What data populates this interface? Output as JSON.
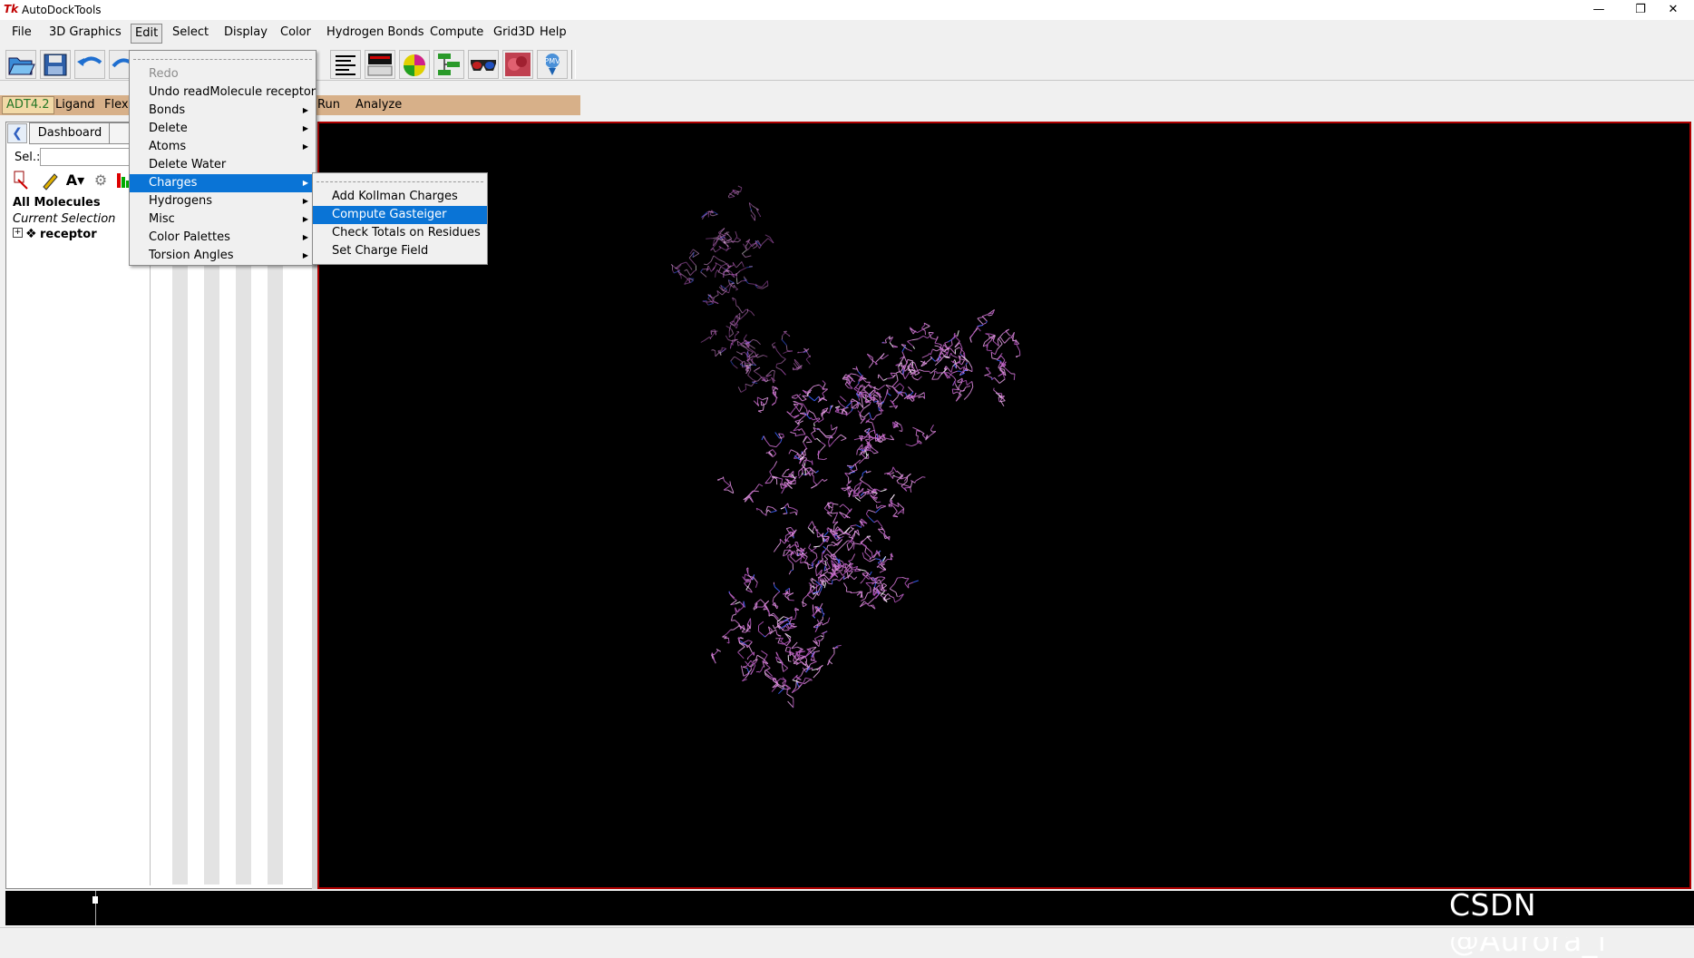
{
  "window": {
    "title": "AutoDockTools",
    "app_icon_text": "Tk",
    "minimize_icon": "minimize-icon",
    "maximize_icon": "restore-icon",
    "close_icon": "close-icon"
  },
  "menubar": {
    "items": [
      "File",
      "3D Graphics",
      "Edit",
      "Select",
      "Display",
      "Color",
      "Hydrogen Bonds",
      "Compute",
      "Grid3D",
      "Help"
    ],
    "active": "Edit"
  },
  "toolbar": {
    "icons": [
      "open-file-icon",
      "save-icon",
      "undo-icon",
      "redo-icon",
      "text-list-icon",
      "console-icon",
      "color-sphere-icon",
      "network-icon",
      "stereo-glasses-icon",
      "surface-icon",
      "python-shell-icon"
    ]
  },
  "adt_menubar": {
    "version": "ADT4.2",
    "items": [
      "Ligand",
      "Flex",
      "Run",
      "Analyze"
    ]
  },
  "dashboard": {
    "tab_label": "Dashboard",
    "sel_label": "Sel.:",
    "sel_value": "",
    "all_molecules": "All Molecules",
    "current_selection": "Current Selection",
    "tree": [
      {
        "expander": "⊞",
        "label": "receptor"
      }
    ]
  },
  "edit_menu": {
    "items": [
      {
        "label": "Redo",
        "disabled": true,
        "submenu": false
      },
      {
        "label": "Undo readMolecule receptor",
        "disabled": false,
        "submenu": false
      },
      {
        "label": "Bonds",
        "disabled": false,
        "submenu": true
      },
      {
        "label": "Delete",
        "disabled": false,
        "submenu": true
      },
      {
        "label": "Atoms",
        "disabled": false,
        "submenu": true
      },
      {
        "label": "Delete Water",
        "disabled": false,
        "submenu": false
      },
      {
        "label": "Charges",
        "disabled": false,
        "submenu": true,
        "highlighted": true
      },
      {
        "label": "Hydrogens",
        "disabled": false,
        "submenu": true
      },
      {
        "label": "Misc",
        "disabled": false,
        "submenu": true
      },
      {
        "label": "Color Palettes",
        "disabled": false,
        "submenu": true
      },
      {
        "label": "Torsion Angles",
        "disabled": false,
        "submenu": true
      }
    ]
  },
  "charges_submenu": {
    "items": [
      {
        "label": "Add Kollman Charges"
      },
      {
        "label": "Compute Gasteiger",
        "highlighted": true
      },
      {
        "label": "Check Totals on Residues"
      },
      {
        "label": "Set Charge Field"
      }
    ]
  },
  "viewer": {
    "background": "#000000",
    "border_color": "#b00000",
    "molecule_color": "#c86ec8"
  },
  "watermark": "CSDN @Aurora_i"
}
